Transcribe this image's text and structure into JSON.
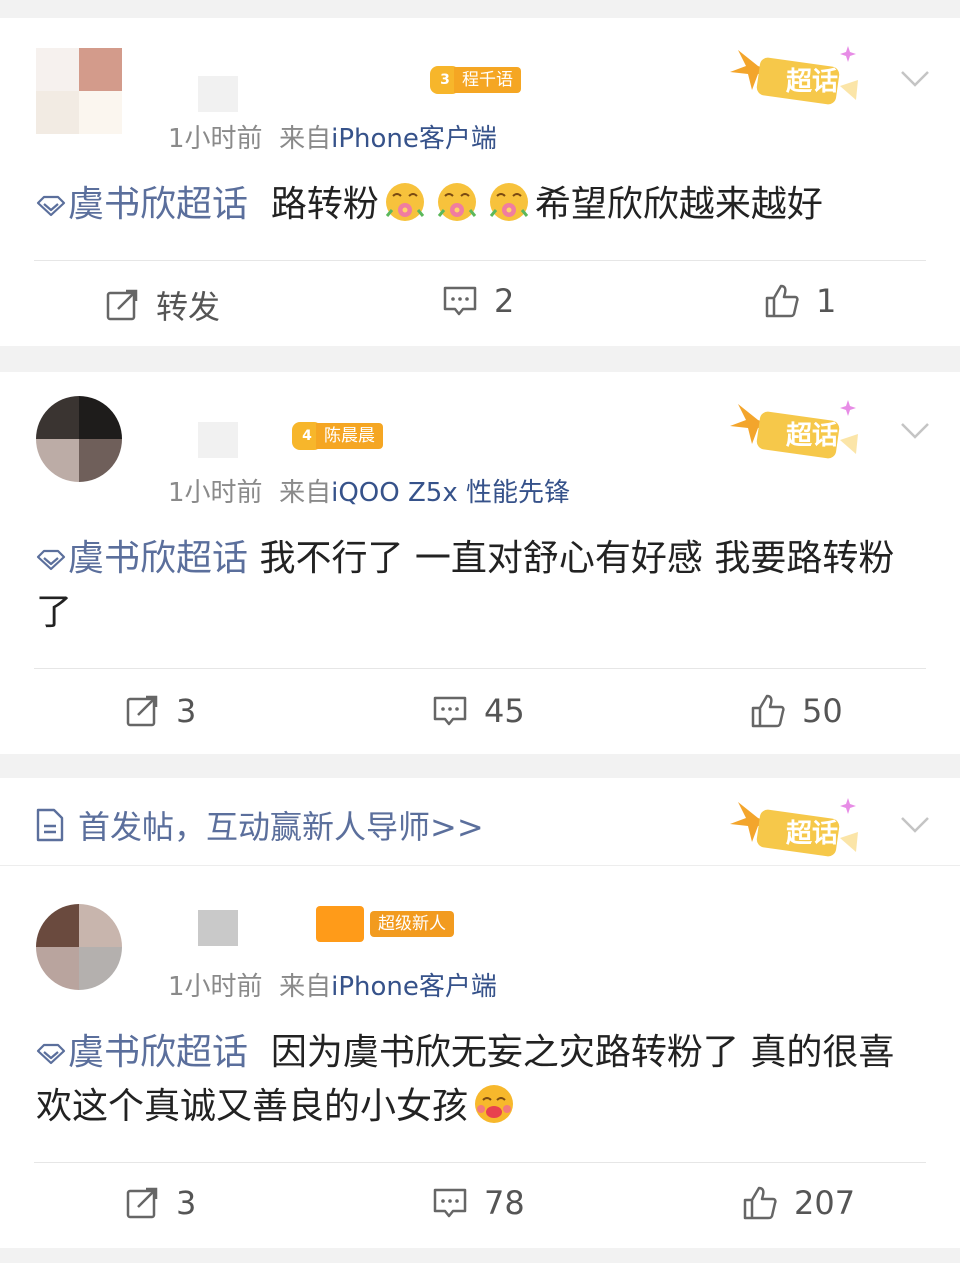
{
  "posts": [
    {
      "badge_level": "3",
      "badge_label": "程千语",
      "time": "1小时前",
      "from_prefix": "来自",
      "source": "iPhone客户端",
      "topic": "虞书欣超话",
      "text_before": "路转粉",
      "text_after": "希望欣欣越来越好",
      "actions": {
        "repost": "转发",
        "comment": "2",
        "like": "1"
      }
    },
    {
      "badge_level": "4",
      "badge_label": "陈晨晨",
      "time": "1小时前",
      "from_prefix": "来自",
      "source": "iQOO Z5x 性能先锋",
      "topic": "虞书欣超话",
      "text": "我不行了 一直对舒心有好感 我要路转粉了",
      "actions": {
        "repost": "3",
        "comment": "45",
        "like": "50"
      }
    },
    {
      "badge_label": "超级新人",
      "time": "1小时前",
      "from_prefix": "来自",
      "source": "iPhone客户端",
      "topic": "虞书欣超话",
      "text": "因为虞书欣无妄之灾路转粉了 真的很喜欢这个真诚又善良的小女孩",
      "actions": {
        "repost": "3",
        "comment": "78",
        "like": "207"
      }
    }
  ],
  "notice": {
    "text": "首发帖，互动赢新人导师>>"
  },
  "super_topic_label": "超话",
  "icons": {
    "topic": "diamond-icon",
    "repost": "repost-icon",
    "comment": "comment-icon",
    "like": "thumbs-up-icon",
    "more": "chevron-down-icon",
    "doc": "document-icon"
  },
  "colors": {
    "link": "#36528a",
    "topic": "#5b6f9c",
    "badge": "#f5a623",
    "meta": "#8a8a8a"
  }
}
